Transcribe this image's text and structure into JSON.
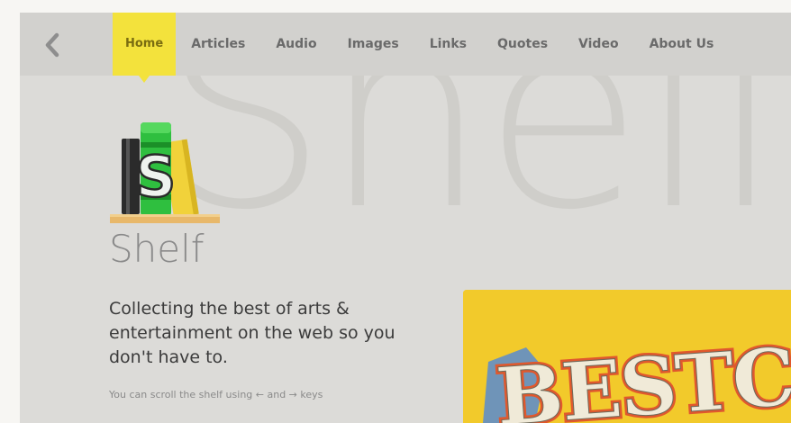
{
  "nav": {
    "items": [
      {
        "label": "Home",
        "active": true
      },
      {
        "label": "Articles",
        "active": false
      },
      {
        "label": "Audio",
        "active": false
      },
      {
        "label": "Images",
        "active": false
      },
      {
        "label": "Links",
        "active": false
      },
      {
        "label": "Quotes",
        "active": false
      },
      {
        "label": "Video",
        "active": false
      },
      {
        "label": "About Us",
        "active": false
      }
    ]
  },
  "hero": {
    "watermark": "Shelf",
    "brand": "Shelf",
    "tagline": "Collecting the best of arts & entertainment on the web so you don't have to.",
    "hint": "You can scroll the shelf using ← and → keys"
  },
  "card": {
    "title": "BESTCOA"
  },
  "colors": {
    "accent": "#f3e23c",
    "background": "#dcdbd8",
    "card": "#f2ca2b"
  },
  "icons": {
    "back": "chevron-left-icon",
    "logo": "shelf-books-logo"
  }
}
